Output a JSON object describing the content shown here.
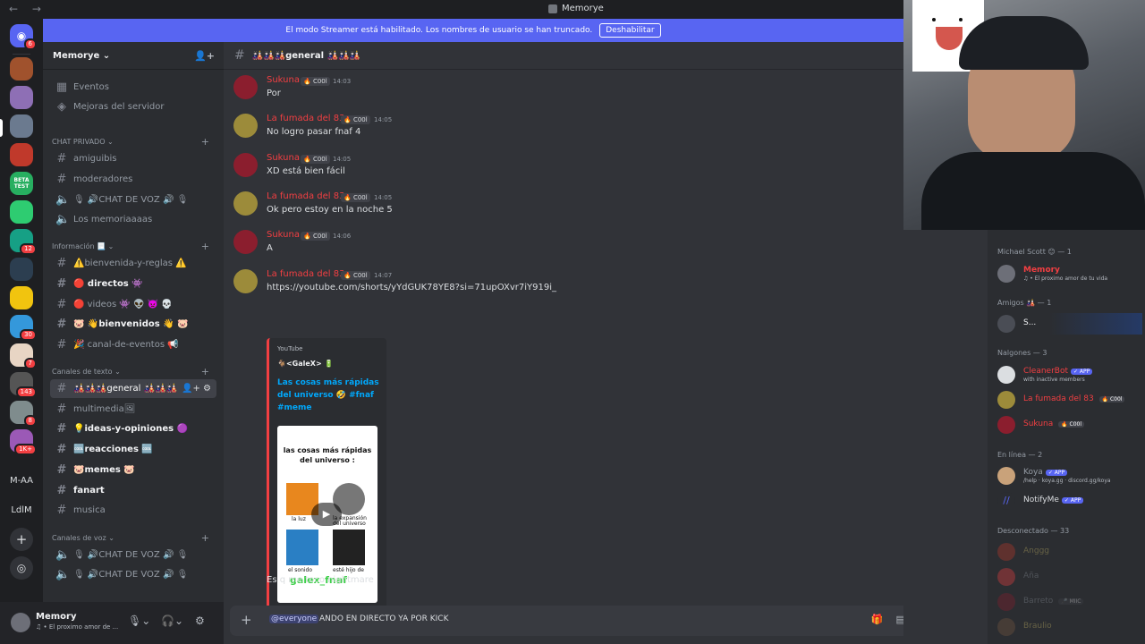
{
  "window": {
    "title": "Memorye"
  },
  "banner": {
    "text": "El modo Streamer está habilitado. Los nombres de usuario se han truncado.",
    "button": "Deshabilitar"
  },
  "guilds": {
    "text_items": [
      "M-AA",
      "LdlM"
    ],
    "badges": [
      "6",
      "12",
      "30",
      "7",
      "143",
      "8",
      "1K+"
    ],
    "beta_label": "BETA TEST"
  },
  "server": {
    "name": "Memorye ⌄"
  },
  "sidebar": {
    "top_items": [
      "Eventos",
      "Mejoras del servidor"
    ],
    "cat_private": "CHAT PRIVADO ⌄",
    "private_items": [
      "amiguibis",
      "moderadores",
      "🎙 🔊CHAT DE VOZ 🔊 🎙",
      "Los memoriaaaas"
    ],
    "cat_info": "Información 📃 ⌄",
    "info_items": [
      "⚠️bienvenida-y-reglas ⚠️",
      "🔴 directos 👾",
      "🔴 videos 👾 👽 👿 💀",
      "🐷 👋bienvenidos 👋 🐷",
      "🎉 canal-de-eventos 📢"
    ],
    "cat_text": "Canales de texto ⌄",
    "text_items": [
      "🎎🎎🎎general 🎎🎎🎎",
      "multimedia🖼",
      "💡ideas-y-opiniones 🟣",
      "🆒reacciones 🆒",
      "🐷memes 🐷",
      "fanart",
      "musica"
    ],
    "cat_voice": "Canales de voz ⌄",
    "voice_items": [
      "🎙 🔊CHAT DE VOZ 🔊 🎙",
      "🎙 🔊CHAT DE VOZ 🔊 🎙"
    ]
  },
  "user": {
    "name": "Memory",
    "status": "♫ • El proximo amor de ..."
  },
  "channel": {
    "title": "🎎🎎🎎general 🎎🎎🎎"
  },
  "messages": [
    {
      "author": "Sukuna",
      "tag": "🔥 C00l",
      "time": "14:03",
      "text": "Por"
    },
    {
      "author": "La fumada del 83",
      "tag": "🔥 C00l",
      "time": "14:05",
      "text": "No logro pasar fnaf 4"
    },
    {
      "author": "Sukuna",
      "tag": "🔥 C00l",
      "time": "14:05",
      "text": "XD está bien fácil"
    },
    {
      "author": "La fumada del 83",
      "tag": "🔥 C00l",
      "time": "14:05",
      "text": "Ok pero estoy en la noche 5"
    },
    {
      "author": "Sukuna",
      "tag": "🔥 C00l",
      "time": "14:06",
      "text": "A"
    },
    {
      "author": "La fumada del 83",
      "tag": "🔥 C00l",
      "time": "14:07",
      "text": "https://youtube.com/shorts/yYdGUK78YE8?si=71upOXvr7iY919i_"
    }
  ],
  "embed": {
    "provider": "YouTube",
    "author": "🐐<GaleX> 🔋",
    "title": "Las cosas más rápidas del universo 🤣 #fnaf #meme",
    "thumb_title": "las cosas más rápidas del universo :",
    "thumb_labels": [
      "la luz",
      "la expansión del universo",
      "el sonido",
      "esté hijo de"
    ],
    "watermark": "galex_fnaf"
  },
  "last_message": "Es q me toco nightmare",
  "composer": {
    "mention": "@everyone",
    "text": " ANDO EN DIRECTO YA POR KICK"
  },
  "members": {
    "roles": [
      {
        "label": "Michael Scott 😊 — 1",
        "items": [
          {
            "name": "Memory",
            "sub": "♫ • El proximo amor de tu vida",
            "color": "#f23f42"
          }
        ]
      },
      {
        "label": "Amigos 🎎 — 1",
        "items": [
          {
            "name": "S...",
            "sub": "",
            "color": "#f2f3f5"
          }
        ]
      },
      {
        "label": "Nalgones — 3",
        "items": [
          {
            "name": "CleanerBot",
            "badge": "✓ APP",
            "sub": "with inactive members",
            "color": "#f23f42"
          },
          {
            "name": "La fumada del 83",
            "badge": "🔥 C00l",
            "sub": "",
            "color": "#f23f42"
          },
          {
            "name": "Sukuna",
            "badge": "🔥 C00l",
            "sub": "",
            "color": "#f23f42"
          }
        ]
      },
      {
        "label": "En línea — 2",
        "items": [
          {
            "name": "Koya",
            "badge": "✓ APP",
            "sub": "/help · koya.gg · discord.gg/koya",
            "color": "#949ba4"
          },
          {
            "name": "NotifyMe",
            "badge": "✓ APP",
            "sub": "",
            "color": "#949ba4"
          }
        ]
      },
      {
        "label": "Desconectado — 33",
        "items": [
          {
            "name": "Anggg",
            "sub": "",
            "color": "#d4c36a"
          },
          {
            "name": "Aña",
            "sub": "",
            "color": "#949ba4"
          },
          {
            "name": "Barreto",
            "badge": "🎤 MIIC",
            "sub": "",
            "color": "#949ba4"
          },
          {
            "name": "Braulio",
            "sub": "",
            "color": "#d4c36a"
          }
        ]
      }
    ]
  },
  "colors": {
    "accent": "#5865f2",
    "danger": "#f23f42",
    "bg": "#313338",
    "sidebar": "#2b2d31"
  }
}
